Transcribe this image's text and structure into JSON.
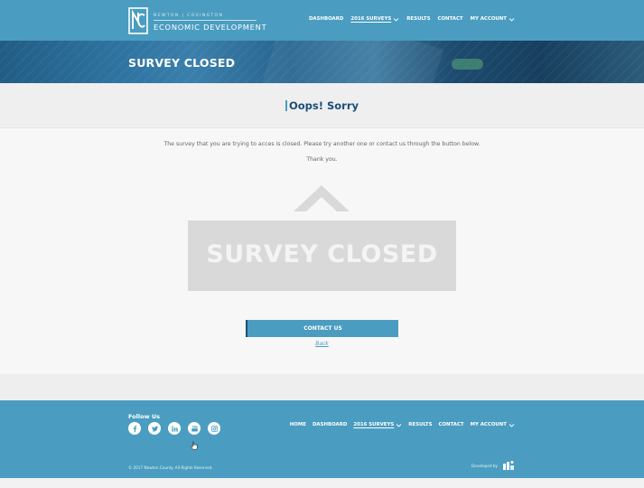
{
  "header": {
    "logo": {
      "top_line": "NEWTON | COVINGTON",
      "bottom_line": "ECONOMIC DEVELOPMENT"
    },
    "nav": [
      {
        "label": "DASHBOARD",
        "dropdown": false,
        "active": false
      },
      {
        "label": "2016 SURVEYS",
        "dropdown": true,
        "active": true
      },
      {
        "label": "RESULTS",
        "dropdown": false,
        "active": false
      },
      {
        "label": "CONTACT",
        "dropdown": false,
        "active": false
      },
      {
        "label": "MY ACCOUNT",
        "dropdown": true,
        "active": false
      }
    ]
  },
  "banner": {
    "title": "SURVEY CLOSED"
  },
  "notice": {
    "title": "Oops! Sorry"
  },
  "content": {
    "message": "The survey that you are trying to acces is closed. Please try another one or contact us through the button below.",
    "thanks": "Thank you.",
    "graphic_text": "SURVEY CLOSED",
    "contact_button": "CONTACT US",
    "back_link": "Back"
  },
  "footer": {
    "follow_label": "Follow Us",
    "socials": [
      "facebook-icon",
      "twitter-icon",
      "linkedin-icon",
      "youtube-icon",
      "instagram-icon"
    ],
    "nav": [
      {
        "label": "HOME",
        "dropdown": false,
        "active": false
      },
      {
        "label": "DASHBOARD",
        "dropdown": false,
        "active": false
      },
      {
        "label": "2016 SURVEYS",
        "dropdown": true,
        "active": true
      },
      {
        "label": "RESULTS",
        "dropdown": false,
        "active": false
      },
      {
        "label": "CONTACT",
        "dropdown": false,
        "active": false
      },
      {
        "label": "MY ACCOUNT",
        "dropdown": true,
        "active": false
      }
    ],
    "copyright": "© 2017 Newton County. All Rights Reserved.",
    "developed_by": "Developed by"
  },
  "colors": {
    "primary": "#4a9dc0",
    "dark_blue": "#1b4f76",
    "graphic_gray": "#d9d9d9"
  }
}
